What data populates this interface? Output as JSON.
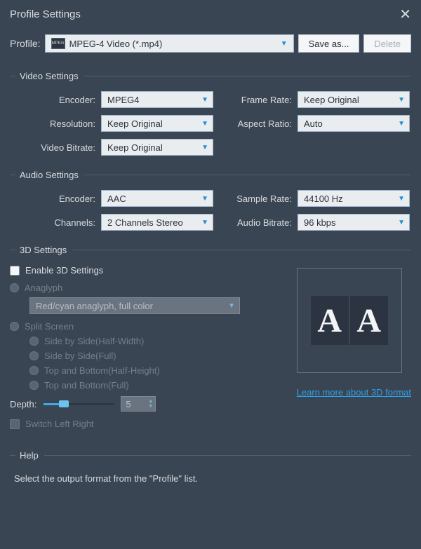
{
  "title": "Profile Settings",
  "profile": {
    "label": "Profile:",
    "iconText": "MPEG",
    "value": "MPEG-4 Video (*.mp4)",
    "save_as": "Save as...",
    "delete": "Delete"
  },
  "video": {
    "header": "Video Settings",
    "encoder_label": "Encoder:",
    "encoder": "MPEG4",
    "resolution_label": "Resolution:",
    "resolution": "Keep Original",
    "bitrate_label": "Video Bitrate:",
    "bitrate": "Keep Original",
    "framerate_label": "Frame Rate:",
    "framerate": "Keep Original",
    "aspect_label": "Aspect Ratio:",
    "aspect": "Auto"
  },
  "audio": {
    "header": "Audio Settings",
    "encoder_label": "Encoder:",
    "encoder": "AAC",
    "channels_label": "Channels:",
    "channels": "2 Channels Stereo",
    "samplerate_label": "Sample Rate:",
    "samplerate": "44100 Hz",
    "bitrate_label": "Audio Bitrate:",
    "bitrate": "96 kbps"
  },
  "three_d": {
    "header": "3D Settings",
    "enable": "Enable 3D Settings",
    "anaglyph": "Anaglyph",
    "anaglyph_mode": "Red/cyan anaglyph, full color",
    "split_screen": "Split Screen",
    "sbs_half": "Side by Side(Half-Width)",
    "sbs_full": "Side by Side(Full)",
    "tab_half": "Top and Bottom(Half-Height)",
    "tab_full": "Top and Bottom(Full)",
    "depth_label": "Depth:",
    "depth_value": "5",
    "switch_lr": "Switch Left Right",
    "learn_more": "Learn more about 3D format",
    "preview_letter": "A"
  },
  "help": {
    "header": "Help",
    "text": "Select the output format from the \"Profile\" list."
  }
}
